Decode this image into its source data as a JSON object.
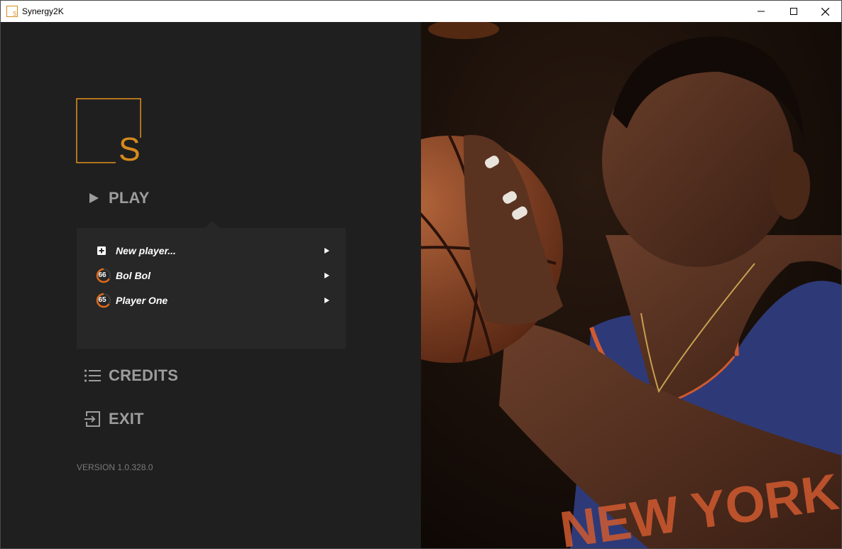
{
  "window": {
    "title": "Synergy2K",
    "controls": [
      "minimize-icon",
      "maximize-icon",
      "close-icon"
    ]
  },
  "logo": {
    "letter": "S",
    "accent": "#d68a1c"
  },
  "menu": {
    "play": {
      "label": "PLAY",
      "icon": "play-icon"
    },
    "credits": {
      "label": "CREDITS",
      "icon": "list-icon"
    },
    "exit": {
      "label": "EXIT",
      "icon": "exit-icon"
    }
  },
  "players": [
    {
      "name": "New player...",
      "icon": "plus-square-icon",
      "rating": null
    },
    {
      "name": "Bol Bol",
      "icon": "rating-ring",
      "rating": "66",
      "progress": 0.66
    },
    {
      "name": "Player One",
      "icon": "rating-ring",
      "rating": "65",
      "progress": 0.65
    }
  ],
  "version": "VERSION 1.0.328.0",
  "colors": {
    "background": "#1f1f1f",
    "panel": "#272727",
    "accent": "#d68a1c",
    "menu_text": "#9d9d9d"
  },
  "hero_image": "photo of basketball player in blue New York jersey holding ball"
}
